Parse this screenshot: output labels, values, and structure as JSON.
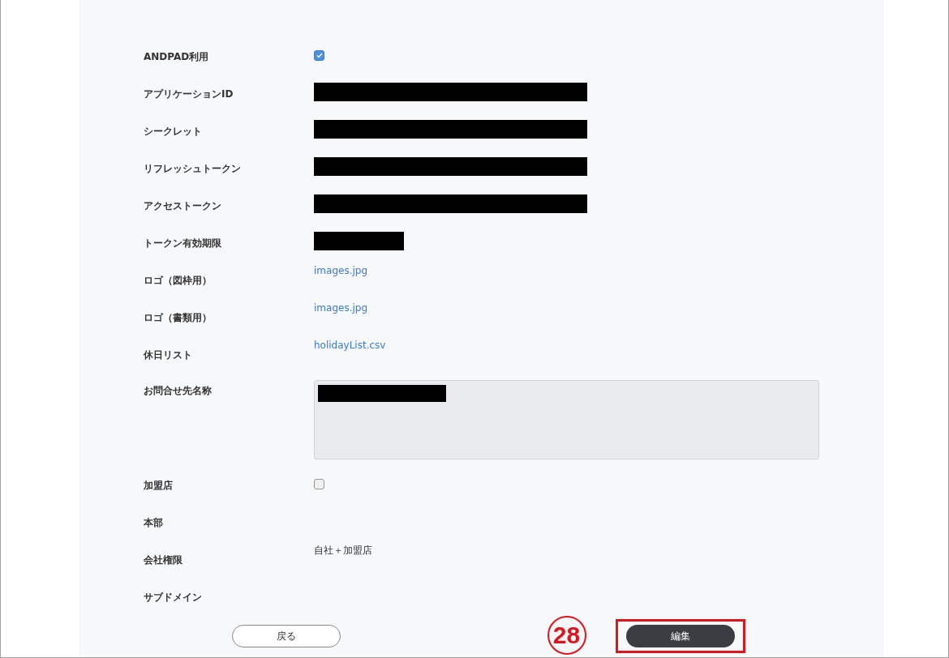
{
  "fields": [
    {
      "label": "ANDPAD利用",
      "kind": "checkbox",
      "checked": true
    },
    {
      "label": "アプリケーションID",
      "kind": "redacted"
    },
    {
      "label": "シークレット",
      "kind": "redacted"
    },
    {
      "label": "リフレッシュトークン",
      "kind": "redacted"
    },
    {
      "label": "アクセストークン",
      "kind": "redacted"
    },
    {
      "label": "トークン有効期限",
      "kind": "redacted_short"
    },
    {
      "label": "ロゴ（図枠用）",
      "kind": "link",
      "value": "images.jpg"
    },
    {
      "label": "ロゴ（書類用）",
      "kind": "link",
      "value": "images.jpg"
    },
    {
      "label": "休日リスト",
      "kind": "link",
      "value": "holidayList.csv"
    },
    {
      "label": "お問合せ先名称",
      "kind": "textarea"
    },
    {
      "label": "加盟店",
      "kind": "checkbox",
      "checked": false
    },
    {
      "label": "本部",
      "kind": "empty"
    },
    {
      "label": "会社権限",
      "kind": "text",
      "value": "自社＋加盟店"
    },
    {
      "label": "サブドメイン",
      "kind": "empty"
    }
  ],
  "buttons": {
    "back": "戻る",
    "edit": "編集"
  },
  "annotation": {
    "number": "28"
  }
}
